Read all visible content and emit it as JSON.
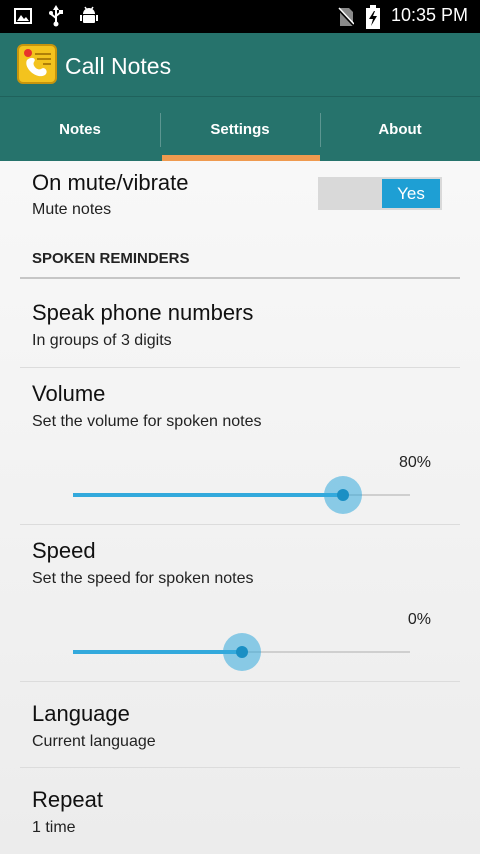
{
  "status_bar": {
    "time": "10:35 PM",
    "icons": [
      "image-icon",
      "usb-icon",
      "android-debug-icon",
      "no-sim-icon",
      "battery-charging-icon"
    ]
  },
  "app": {
    "title": "Call Notes",
    "icon": "call-notes-app-icon"
  },
  "tabs": [
    {
      "label": "Notes",
      "selected": false
    },
    {
      "label": "Settings",
      "selected": true
    },
    {
      "label": "About",
      "selected": false
    }
  ],
  "colors": {
    "primary": "#26736c",
    "tab_indicator": "#ef9a4f",
    "accent": "#33a9dc"
  },
  "settings": {
    "mute": {
      "title": "On mute/vibrate",
      "subtitle": "Mute notes",
      "toggle_value": "Yes"
    },
    "section_header": "SPOKEN REMINDERS",
    "speak_numbers": {
      "title": "Speak phone numbers",
      "subtitle": "In groups of 3 digits"
    },
    "volume": {
      "title": "Volume",
      "subtitle": "Set the volume for spoken notes",
      "percent_label": "80%",
      "level": 0.8
    },
    "speed": {
      "title": "Speed",
      "subtitle": "Set the speed for spoken notes",
      "percent_label": "0%",
      "level": 0.5
    },
    "language": {
      "title": "Language",
      "subtitle": "Current language"
    },
    "repeat": {
      "title": "Repeat",
      "subtitle": "1 time"
    }
  }
}
